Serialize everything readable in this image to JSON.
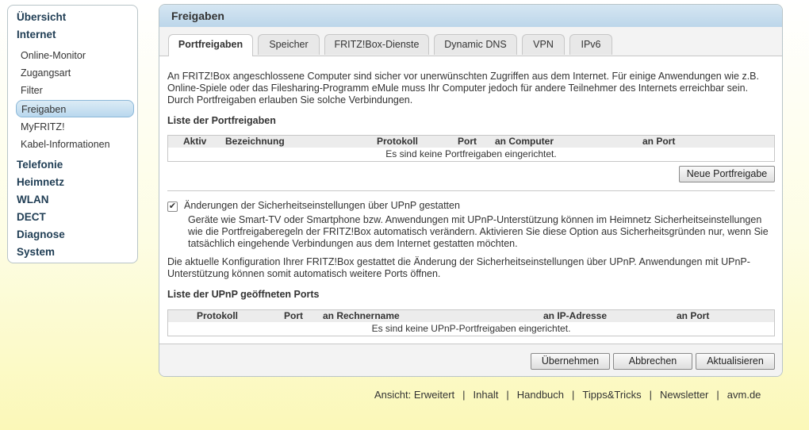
{
  "sidebar": {
    "main_items": [
      "Übersicht",
      "Internet",
      "Telefonie",
      "Heimnetz",
      "WLAN",
      "DECT",
      "Diagnose",
      "System"
    ],
    "sub_items": [
      "Online-Monitor",
      "Zugangsart",
      "Filter",
      "Freigaben",
      "MyFRITZ!",
      "Kabel-Informationen"
    ]
  },
  "main": {
    "title": "Freigaben",
    "tabs": [
      "Portfreigaben",
      "Speicher",
      "FRITZ!Box-Dienste",
      "Dynamic DNS",
      "VPN",
      "IPv6"
    ],
    "intro": "An FRITZ!Box angeschlossene Computer sind sicher vor unerwünschten Zugriffen aus dem Internet. Für einige Anwendungen wie z.B. Online-Spiele oder das Filesharing-Programm eMule muss Ihr Computer jedoch für andere Teilnehmer des Internets erreichbar sein. Durch Portfreigaben erlauben Sie solche Verbindungen.",
    "port_list": {
      "heading": "Liste der Portfreigaben",
      "columns": [
        "Aktiv",
        "Bezeichnung",
        "Protokoll",
        "Port",
        "an Computer",
        "an Port"
      ],
      "empty": "Es sind keine Portfreigaben eingerichtet."
    },
    "new_button": "Neue Portfreigabe",
    "upnp": {
      "checkbox_label": "Änderungen der Sicherheitseinstellungen über UPnP gestatten",
      "checked": true,
      "description": "Geräte wie Smart-TV oder Smartphone bzw. Anwendungen mit UPnP-Unterstützung können im Heimnetz Sicherheitseinstellungen wie die Portfreigaberegeln der FRITZ!Box automatisch verändern. Aktivieren Sie diese Option aus Sicherheitsgründen nur, wenn Sie tatsächlich eingehende Verbindungen aus dem Internet gestatten möchten.",
      "config_note": "Die aktuelle Konfiguration Ihrer FRITZ!Box gestattet die Änderung der Sicherheitseinstellungen über UPnP. Anwendungen mit UPnP-Unterstützung können somit automatisch weitere Ports öffnen."
    },
    "upnp_list": {
      "heading": "Liste der UPnP geöffneten Ports",
      "columns": [
        "Protokoll",
        "Port",
        "an Rechnername",
        "an IP-Adresse",
        "an Port"
      ],
      "empty": "Es sind keine UPnP-Portfreigaben eingerichtet."
    },
    "buttons": {
      "apply": "Übernehmen",
      "cancel": "Abbrechen",
      "refresh": "Aktualisieren"
    }
  },
  "footer": {
    "links": [
      "Ansicht: Erweitert",
      "Inhalt",
      "Handbuch",
      "Tipps&Tricks",
      "Newsletter",
      "avm.de"
    ],
    "separator": "|"
  },
  "icons": {
    "checkbox": "checkmark-icon"
  }
}
